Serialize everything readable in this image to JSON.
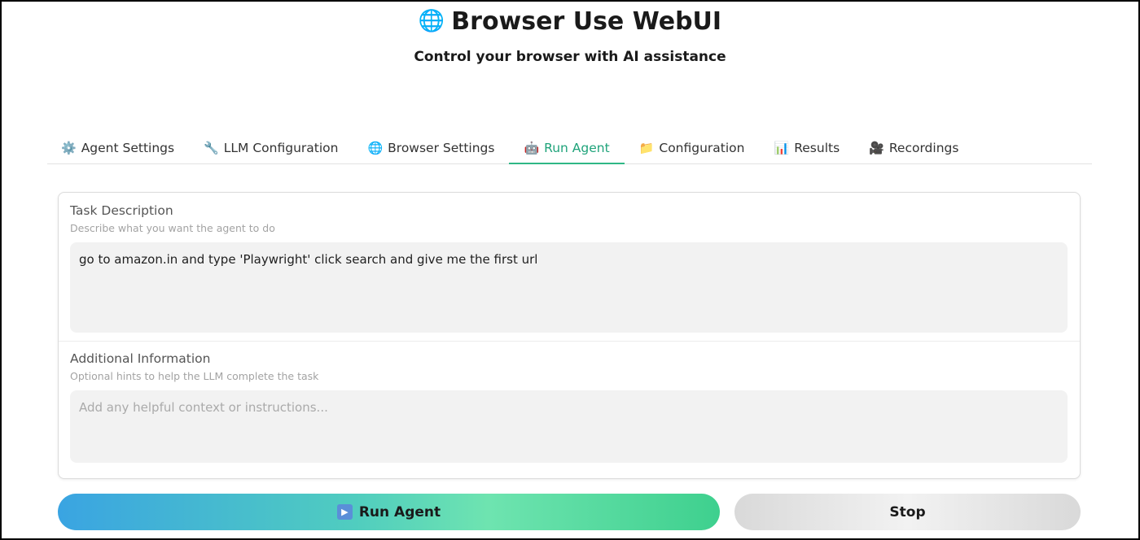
{
  "app": {
    "title_icon": "globe-icon",
    "title": "Browser Use WebUI",
    "subtitle": "Control your browser with AI assistance"
  },
  "tabs": [
    {
      "icon": "⚙️",
      "icon_name": "gear-icon",
      "label": "Agent Settings",
      "active": false
    },
    {
      "icon": "🔧",
      "icon_name": "wrench-icon",
      "label": "LLM Configuration",
      "active": false
    },
    {
      "icon": "🌐",
      "icon_name": "globe-icon",
      "label": "Browser Settings",
      "active": false
    },
    {
      "icon": "🤖",
      "icon_name": "robot-icon",
      "label": "Run Agent",
      "active": true
    },
    {
      "icon": "📁",
      "icon_name": "folder-icon",
      "label": "Configuration",
      "active": false
    },
    {
      "icon": "📊",
      "icon_name": "bar-chart-icon",
      "label": "Results",
      "active": false
    },
    {
      "icon": "🎥",
      "icon_name": "video-camera-icon",
      "label": "Recordings",
      "active": false
    }
  ],
  "task": {
    "label": "Task Description",
    "hint": "Describe what you want the agent to do",
    "value": "go to amazon.in and type 'Playwright' click search and give me the first url"
  },
  "additional": {
    "label": "Additional Information",
    "hint": "Optional hints to help the LLM complete the task",
    "placeholder": "Add any helpful context or instructions..."
  },
  "buttons": {
    "run_label": "Run Agent",
    "run_icon": "play-icon",
    "stop_label": "Stop"
  },
  "colors": {
    "accent": "#2fb886",
    "run_gradient_start": "#3aa4e2",
    "run_gradient_end": "#3ed08e"
  }
}
